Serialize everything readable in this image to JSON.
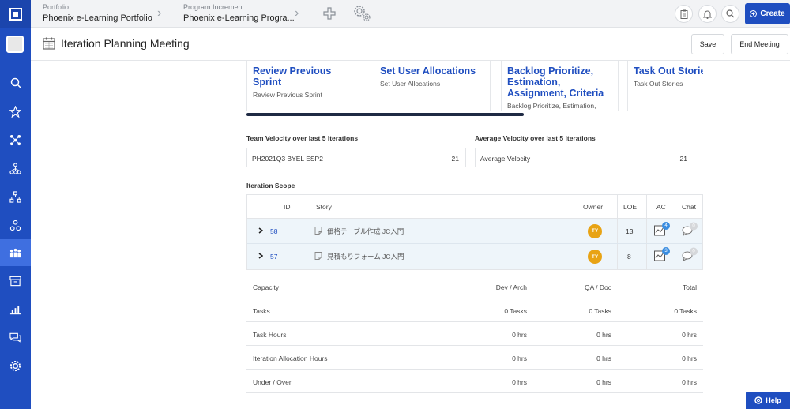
{
  "breadcrumb": {
    "portfolio_label": "Portfolio:",
    "portfolio_value": "Phoenix e-Learning Portfolio",
    "pi_label": "Program Increment:",
    "pi_value": "Phoenix e-Learning Progra..."
  },
  "topbar": {
    "create_label": "Create"
  },
  "page": {
    "title": "Iteration Planning Meeting",
    "save_label": "Save",
    "end_label": "End Meeting"
  },
  "agenda_cards": [
    {
      "title": "Review Previous Sprint",
      "subtitle": "Review Previous Sprint"
    },
    {
      "title": "Set User Allocations",
      "subtitle": "Set User Allocations"
    },
    {
      "title": "Backlog Prioritize, Estimation, Assignment, Criteria",
      "subtitle": "Backlog Prioritize, Estimation,"
    },
    {
      "title": "Task Out Stories",
      "subtitle": "Task Out Stories"
    }
  ],
  "team_velocity": {
    "heading": "Team Velocity over last 5 Iterations",
    "label": "PH2021Q3 BYEL ESP2",
    "value": "21"
  },
  "avg_velocity": {
    "heading": "Average Velocity over last 5 Iterations",
    "label": "Average Velocity",
    "value": "21"
  },
  "scope": {
    "heading": "Iteration Scope",
    "columns": {
      "id": "ID",
      "story": "Story",
      "owner": "Owner",
      "loe": "LOE",
      "ac": "AC",
      "chat": "Chat"
    },
    "rows": [
      {
        "id": "58",
        "story": "価格テーブル作成 JC入門",
        "owner": "TY",
        "loe": "13",
        "ac": "4",
        "chat": "0"
      },
      {
        "id": "57",
        "story": "見積もりフォーム JC入門",
        "owner": "TY",
        "loe": "8",
        "ac": "3",
        "chat": "0"
      }
    ]
  },
  "capacity": {
    "columns": {
      "name": "Capacity",
      "dev": "Dev / Arch",
      "qa": "QA / Doc",
      "total": "Total"
    },
    "rows": [
      {
        "name": "Tasks",
        "dev": "0 Tasks",
        "qa": "0 Tasks",
        "total": "0 Tasks"
      },
      {
        "name": "Task Hours",
        "dev": "0 hrs",
        "qa": "0 hrs",
        "total": "0 hrs"
      },
      {
        "name": "Iteration Allocation Hours",
        "dev": "0 hrs",
        "qa": "0 hrs",
        "total": "0 hrs"
      },
      {
        "name": "Under / Over",
        "dev": "0 hrs",
        "qa": "0 hrs",
        "total": "0 hrs"
      }
    ]
  },
  "help_label": "Help",
  "colors": {
    "brand": "#1f4ec0",
    "owner_avatar": "#e8a314",
    "row_highlight": "#eef5fa"
  },
  "rail_icons": [
    "logo-icon",
    "search-icon",
    "star-icon",
    "network-icon",
    "hierarchy-icon",
    "org-chart-icon",
    "nodes-icon",
    "team-icon",
    "archive-icon",
    "chart-icon",
    "chat-icon",
    "gear-icon"
  ]
}
